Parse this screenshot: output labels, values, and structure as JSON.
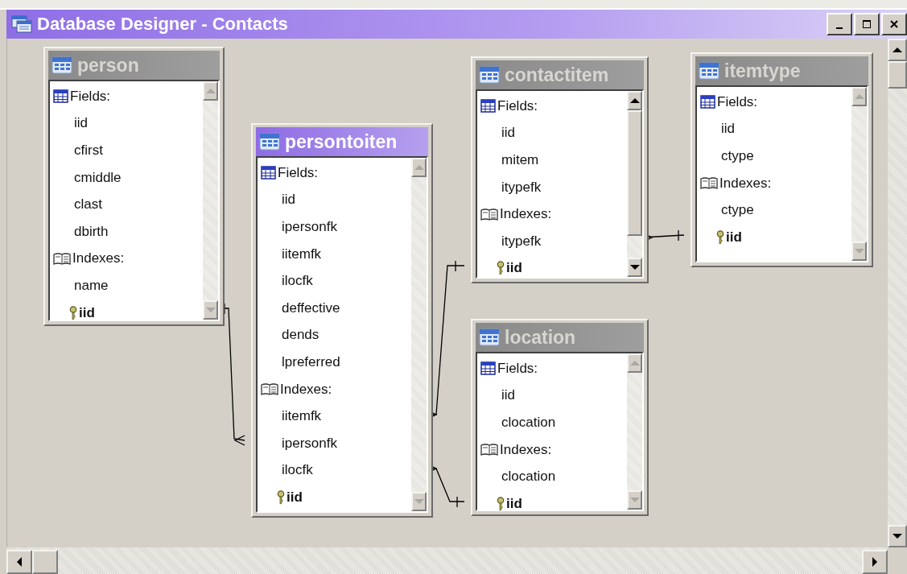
{
  "window": {
    "title": "Database Designer - Contacts"
  },
  "tables": [
    {
      "name": "person",
      "active": false,
      "scrollable": false,
      "rows": [
        {
          "kind": "fields-header",
          "text": "Fields:"
        },
        {
          "kind": "item",
          "text": "iid"
        },
        {
          "kind": "item",
          "text": "cfirst"
        },
        {
          "kind": "item",
          "text": "cmiddle"
        },
        {
          "kind": "item",
          "text": "clast"
        },
        {
          "kind": "item",
          "text": "dbirth"
        },
        {
          "kind": "indexes-header",
          "text": "Indexes:"
        },
        {
          "kind": "item",
          "text": "name"
        },
        {
          "kind": "key",
          "text": "iid"
        }
      ]
    },
    {
      "name": "persontoiten",
      "active": true,
      "scrollable": false,
      "rows": [
        {
          "kind": "fields-header",
          "text": "Fields:"
        },
        {
          "kind": "item",
          "text": "iid"
        },
        {
          "kind": "item",
          "text": "ipersonfk"
        },
        {
          "kind": "item",
          "text": "iitemfk"
        },
        {
          "kind": "item",
          "text": "ilocfk"
        },
        {
          "kind": "item",
          "text": "deffective"
        },
        {
          "kind": "item",
          "text": "dends"
        },
        {
          "kind": "item",
          "text": "lpreferred"
        },
        {
          "kind": "indexes-header",
          "text": "Indexes:"
        },
        {
          "kind": "item",
          "text": "iitemfk"
        },
        {
          "kind": "item",
          "text": "ipersonfk"
        },
        {
          "kind": "item",
          "text": "ilocfk"
        },
        {
          "kind": "key",
          "text": "iid"
        }
      ]
    },
    {
      "name": "contactitem",
      "active": false,
      "scrollable": true,
      "rows": [
        {
          "kind": "fields-header",
          "text": "Fields:"
        },
        {
          "kind": "item",
          "text": "iid"
        },
        {
          "kind": "item",
          "text": "mitem"
        },
        {
          "kind": "item",
          "text": "itypefk"
        },
        {
          "kind": "indexes-header",
          "text": "Indexes:"
        },
        {
          "kind": "item",
          "text": "itypefk"
        },
        {
          "kind": "key",
          "text": "iid"
        }
      ]
    },
    {
      "name": "itemtype",
      "active": false,
      "scrollable": false,
      "rows": [
        {
          "kind": "fields-header",
          "text": "Fields:"
        },
        {
          "kind": "item",
          "text": "iid"
        },
        {
          "kind": "item",
          "text": "ctype"
        },
        {
          "kind": "indexes-header",
          "text": "Indexes:"
        },
        {
          "kind": "item",
          "text": "ctype"
        },
        {
          "kind": "key",
          "text": "iid"
        }
      ]
    },
    {
      "name": "location",
      "active": false,
      "scrollable": false,
      "rows": [
        {
          "kind": "fields-header",
          "text": "Fields:"
        },
        {
          "kind": "item",
          "text": "iid"
        },
        {
          "kind": "item",
          "text": "clocation"
        },
        {
          "kind": "indexes-header",
          "text": "Indexes:"
        },
        {
          "kind": "item",
          "text": "clocation"
        },
        {
          "kind": "key",
          "text": "iid"
        }
      ]
    }
  ]
}
